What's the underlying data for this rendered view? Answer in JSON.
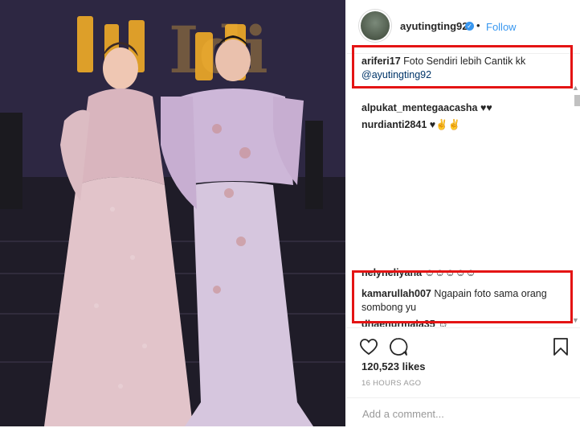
{
  "post": {
    "username": "ayutingting92",
    "follow_label": "Follow",
    "separator": "•"
  },
  "photo_sign": "Idi",
  "comments": [
    {
      "user": "ariferi17",
      "text": "Foto Sendiri lebih Cantik kk"
    },
    {
      "mention": "@ayutingting92"
    },
    {
      "user": "alpukat_mentegaacasha",
      "text": "♥♥"
    },
    {
      "user": "nurdianti2841",
      "text": "♥✌✌"
    },
    {
      "user": "nelyneliyana",
      "text": "☺☺☺☺☺"
    },
    {
      "user": "kamarullah007",
      "text": "Ngapain foto sama orang"
    },
    {
      "text": "sombong yu"
    },
    {
      "user": "dhaenurmala35",
      "text": "☺"
    }
  ],
  "likes": "120,523 likes",
  "time": "16 HOURS AGO",
  "add_comment_placeholder": "Add a comment...",
  "colors": {
    "accent": "#3897f0",
    "highlight_box": "#e41414",
    "muted": "#999999"
  },
  "icons": [
    "heart-icon",
    "comment-icon",
    "bookmark-icon",
    "verified-icon"
  ]
}
